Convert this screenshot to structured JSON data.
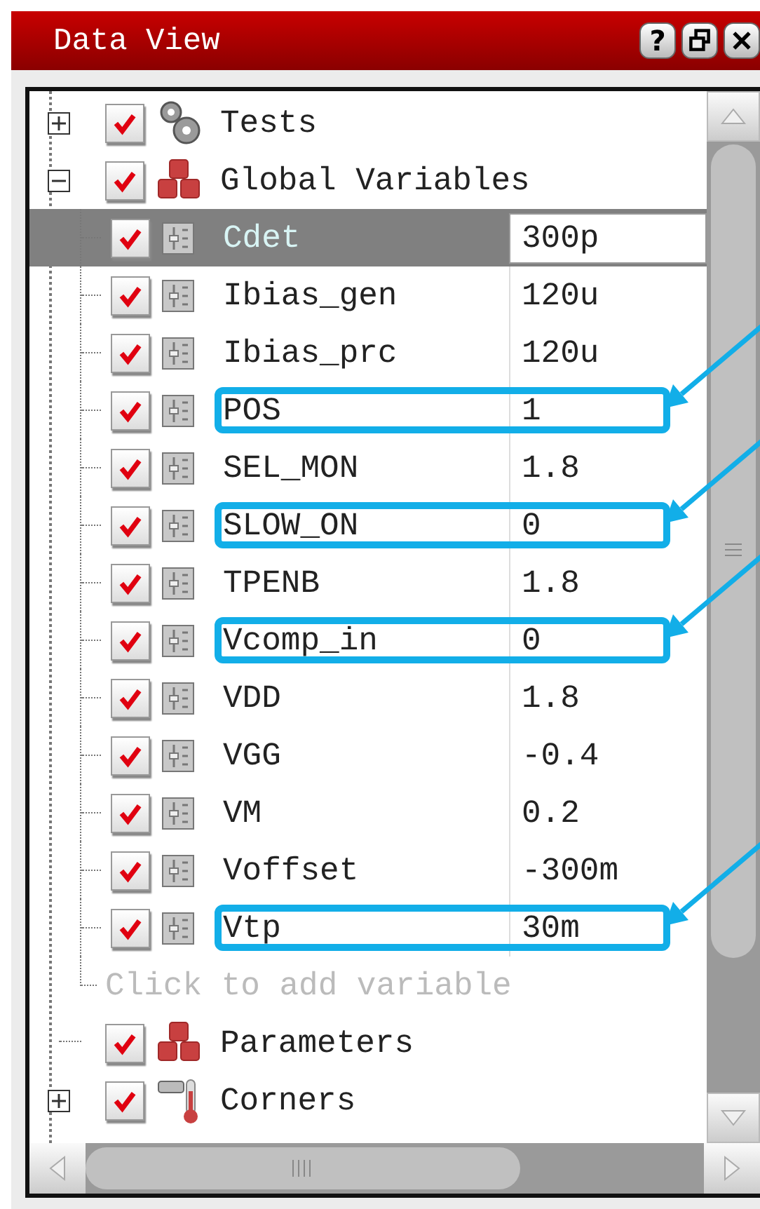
{
  "window": {
    "title": "Data View",
    "buttons": [
      "?"
    ]
  },
  "tree": [
    {
      "label": "Tests",
      "kind": "tests",
      "checked": true,
      "has_children": true,
      "expanded": false
    },
    {
      "label": "Global Variables",
      "kind": "variables",
      "checked": true,
      "has_children": true,
      "expanded": true,
      "children": [
        {
          "name": "Cdet",
          "value": "300p",
          "checked": true,
          "selected": true,
          "highlighted": false
        },
        {
          "name": "Ibias_gen",
          "value": "120u",
          "checked": true,
          "selected": false,
          "highlighted": false
        },
        {
          "name": "Ibias_prc",
          "value": "120u",
          "checked": true,
          "selected": false,
          "highlighted": false
        },
        {
          "name": "POS",
          "value": "1",
          "checked": true,
          "selected": false,
          "highlighted": true
        },
        {
          "name": "SEL_MON",
          "value": "1.8",
          "checked": true,
          "selected": false,
          "highlighted": false
        },
        {
          "name": "SLOW_ON",
          "value": "0",
          "checked": true,
          "selected": false,
          "highlighted": true
        },
        {
          "name": "TPENB",
          "value": "1.8",
          "checked": true,
          "selected": false,
          "highlighted": false
        },
        {
          "name": "Vcomp_in",
          "value": "0",
          "checked": true,
          "selected": false,
          "highlighted": true
        },
        {
          "name": "VDD",
          "value": "1.8",
          "checked": true,
          "selected": false,
          "highlighted": false
        },
        {
          "name": "VGG",
          "value": "-0.4",
          "checked": true,
          "selected": false,
          "highlighted": false
        },
        {
          "name": "VM",
          "value": "0.2",
          "checked": true,
          "selected": false,
          "highlighted": false
        },
        {
          "name": "Voffset",
          "value": "-300m",
          "checked": true,
          "selected": false,
          "highlighted": false
        },
        {
          "name": "Vtp",
          "value": "30m",
          "checked": true,
          "selected": false,
          "highlighted": true
        }
      ],
      "add_placeholder": "Click to add variable"
    },
    {
      "label": "Parameters",
      "kind": "variables",
      "checked": true,
      "has_children": false,
      "expanded": false
    },
    {
      "label": "Corners",
      "kind": "corners",
      "checked": true,
      "has_children": true,
      "expanded": false
    }
  ]
}
